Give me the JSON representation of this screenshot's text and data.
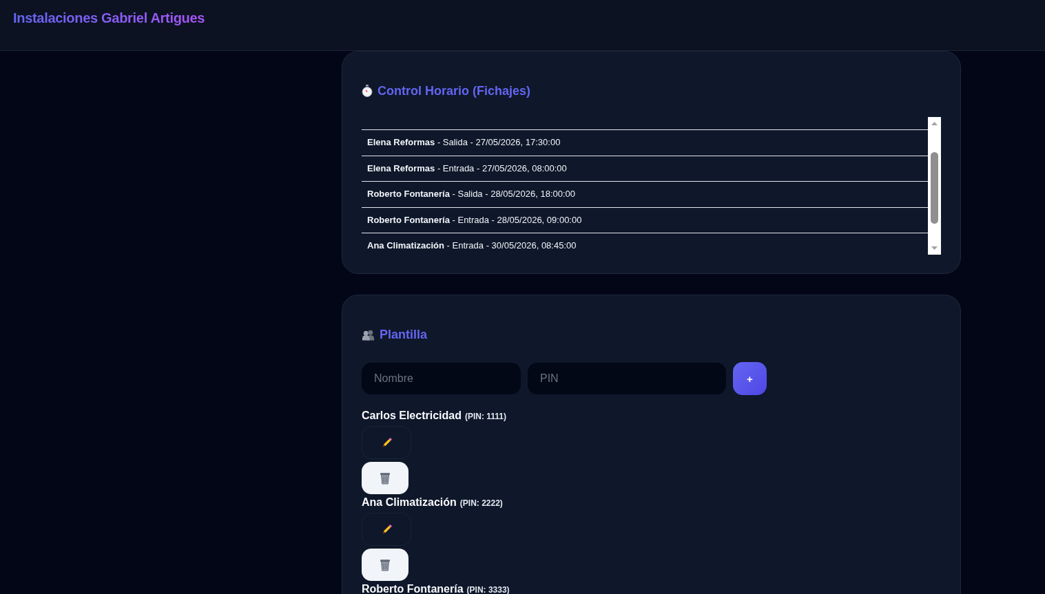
{
  "header": {
    "title": "Instalaciones Gabriel Artigues"
  },
  "control_horario": {
    "title": "Control Horario (Fichajes)",
    "entries": [
      {
        "text": "**Elena Reformas** - Salida - 27/05/2026, 17:30:00"
      },
      {
        "text": "**Elena Reformas** - Entrada - 27/05/2026, 08:00:00"
      },
      {
        "text": "**Roberto Fontanería** - Salida - 28/05/2026, 18:00:00"
      },
      {
        "text": "**Roberto Fontanería** - Entrada - 28/05/2026, 09:00:00"
      },
      {
        "text": "**Ana Climatización** - Entrada - 30/05/2026, 08:45:00"
      }
    ]
  },
  "plantilla": {
    "title": "Plantilla",
    "form": {
      "name_field": {
        "placeholder": "Nombre"
      },
      "pin_field": {
        "placeholder": "PIN"
      },
      "add_button": "+"
    },
    "employees": [
      {
        "name": "Carlos Electricidad",
        "pin": "(PIN: 1111)"
      },
      {
        "name": "Ana Climatización",
        "pin": "(PIN: 2222)"
      },
      {
        "name": "Roberto Fontanería",
        "pin": "(PIN: 3333)"
      }
    ]
  }
}
